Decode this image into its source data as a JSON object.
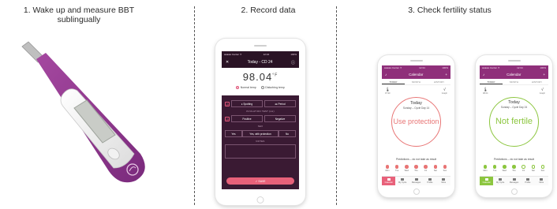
{
  "steps": {
    "step1": {
      "line1": "1. Wake up and measure BBT",
      "line2": "sublingually"
    },
    "step2": {
      "title": "2. Record data"
    },
    "step3": {
      "title": "3. Check fertility status"
    }
  },
  "colors": {
    "purple": "#8f2f7a",
    "dark_plum": "#3a1a33",
    "coral": "#e8617a",
    "red_ring": "#e87575",
    "green_ring": "#8cc63f"
  },
  "record_screen": {
    "status_left": "●●●●● Carrier ✈",
    "status_time": "12:34",
    "status_right": "100%",
    "header_title": "Today - CD 24",
    "close_glyph": "✕",
    "temperature": "98.04",
    "unit": "°F",
    "radio_normal": "Normal temp",
    "radio_disturbing": "Disturbing temp",
    "period_spotting": "Spotting",
    "period_period": "Period",
    "ovulation_label": "OVULATION TEST (LH)",
    "ovulation_positive": "Positive",
    "ovulation_negative": "Negative",
    "sex_label": "SEX",
    "sex_yes": "Yes",
    "sex_protected": "Yes, with protection",
    "sex_no": "No",
    "notes_label": "NOTES",
    "save_label": "✓ SAVE"
  },
  "calendar_red": {
    "status_left": "●●●●● Carrier ✈",
    "status_time": "12:34",
    "status_right": "100%",
    "title": "Calendar",
    "tabs": [
      "TODAY",
      "MONTH",
      "HISTORY"
    ],
    "left_value": "",
    "left_caption": "97.90",
    "right_caption": "Graph",
    "today_label": "Today",
    "cycle_line": "Sunday – Cycle Day 14",
    "status_text": "Use protection",
    "predictions_label": "Predictions – do not take as result",
    "day_labels": [
      "Mon",
      "Tue",
      "Wed",
      "Thu",
      "Fri",
      "Sat",
      "Sun"
    ],
    "tabbar": [
      "Calendar",
      "My Cycle",
      "Messages",
      "Profile",
      "More"
    ]
  },
  "calendar_green": {
    "status_left": "●●●●● Carrier ✈",
    "status_time": "12:34",
    "status_right": "100%",
    "title": "Calendar",
    "tabs": [
      "TODAY",
      "MONTH",
      "HISTORY"
    ],
    "left_caption": "98.04",
    "right_caption": "Graph",
    "today_label": "Today",
    "cycle_line": "Sunday – Cycle Day 24",
    "status_text": "Not fertile",
    "predictions_label": "Predictions – do not take as result",
    "day_labels": [
      "Mon",
      "Tue",
      "Wed",
      "Thu",
      "Fri",
      "Sat",
      "Sun"
    ],
    "tabbar": [
      "Calendar",
      "My Cycle",
      "Messages",
      "Profile",
      "More"
    ]
  }
}
